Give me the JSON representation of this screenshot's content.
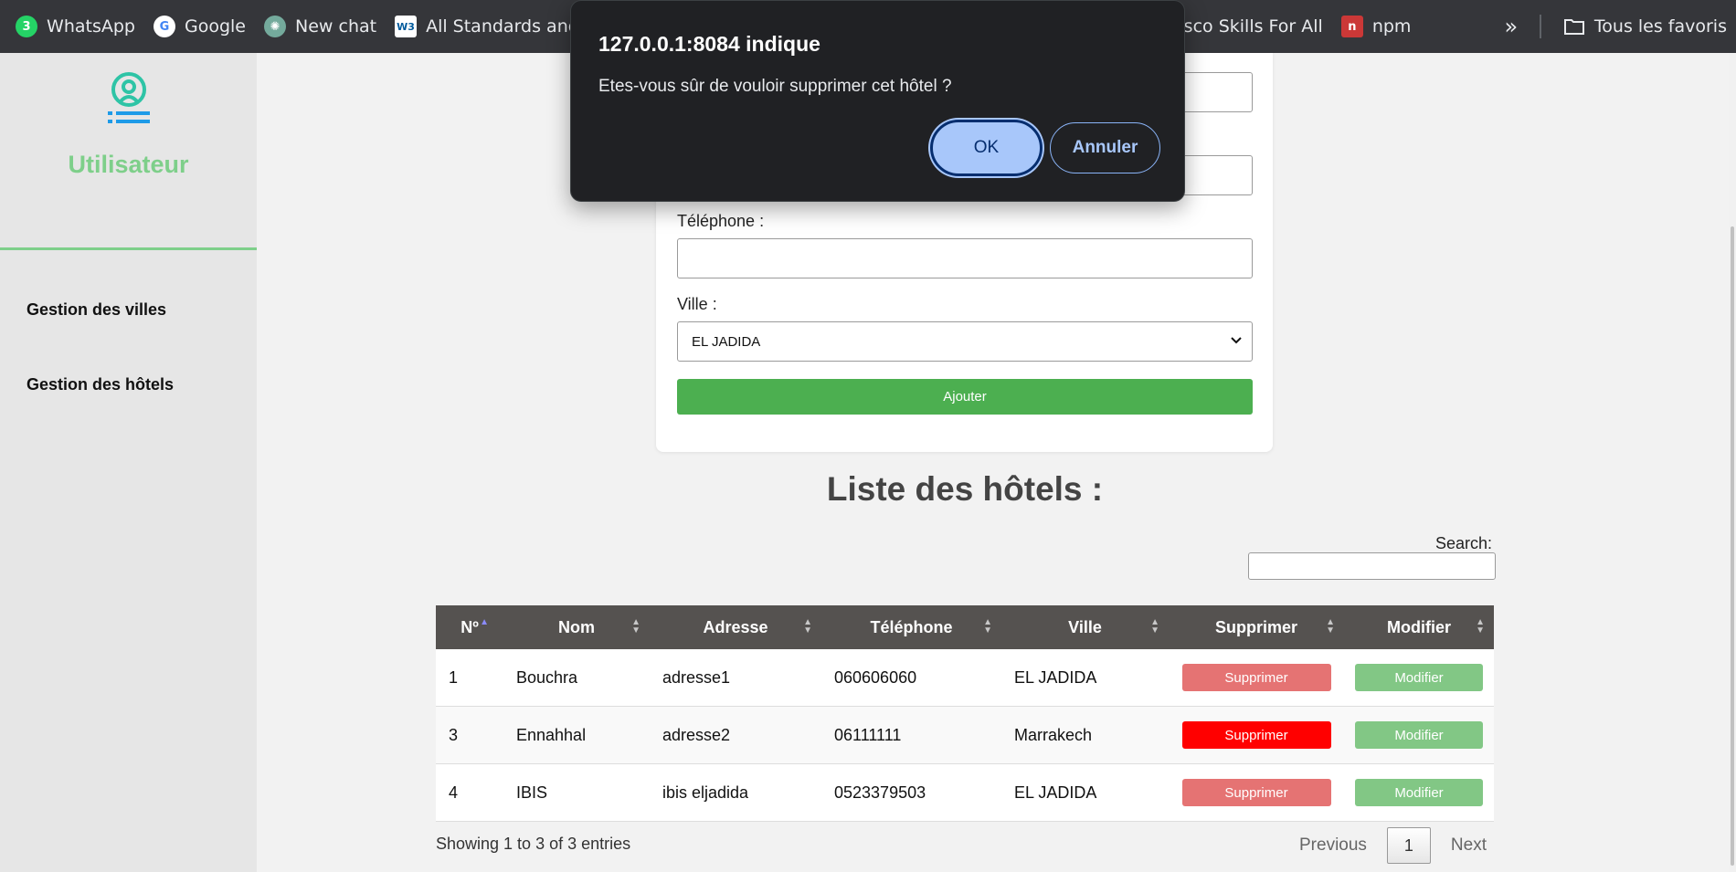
{
  "bookmarks": {
    "items": [
      {
        "label": "WhatsApp",
        "icon": "whatsapp-icon",
        "color": "#25d366",
        "glyph": "3"
      },
      {
        "label": "Google",
        "icon": "google-icon",
        "color": "#4285f4",
        "glyph": "G"
      },
      {
        "label": "New chat",
        "icon": "chatgpt-icon",
        "color": "#74aa9c",
        "glyph": "✺"
      },
      {
        "label": "All Standards and D...",
        "icon": "w3c-icon",
        "color": "#ffffff",
        "glyph": "W3"
      },
      {
        "label": "Cisco Skills For All",
        "icon": "cisco-icon",
        "color": "#35363a",
        "glyph": "cisco"
      },
      {
        "label": "npm",
        "icon": "npm-icon",
        "color": "#cb3837",
        "glyph": "n"
      }
    ],
    "more_glyph": "»",
    "favorites_label": "Tous les favoris"
  },
  "sidebar": {
    "brand": "Utilisateur",
    "brand_color": "#7ecf8a",
    "links": [
      "Gestion des villes",
      "Gestion des hôtels"
    ]
  },
  "form": {
    "telephone_label": "Téléphone :",
    "ville_label": "Ville :",
    "ville_selected": "EL JADIDA",
    "submit_label": "Ajouter",
    "submit_color": "#4caf50"
  },
  "list": {
    "title": "Liste des hôtels :",
    "search_label": "Search:",
    "columns": [
      "Nº",
      "Nom",
      "Adresse",
      "Téléphone",
      "Ville",
      "Supprimer",
      "Modifier"
    ],
    "rows": [
      {
        "num": "1",
        "nom": "Bouchra",
        "adresse": "adresse1",
        "telephone": "060606060",
        "ville": "EL JADIDA",
        "delete_label": "Supprimer",
        "edit_label": "Modifier",
        "delete_color": "#e57373"
      },
      {
        "num": "3",
        "nom": "Ennahhal",
        "adresse": "adresse2",
        "telephone": "06111111",
        "ville": "Marrakech",
        "delete_label": "Supprimer",
        "edit_label": "Modifier",
        "delete_color": "#ff0000"
      },
      {
        "num": "4",
        "nom": "IBIS",
        "adresse": "ibis eljadida",
        "telephone": "0523379503",
        "ville": "EL JADIDA",
        "delete_label": "Supprimer",
        "edit_label": "Modifier",
        "delete_color": "#e57373"
      }
    ],
    "info": "Showing 1 to 3 of 3 entries",
    "pager": {
      "previous": "Previous",
      "current": "1",
      "next": "Next"
    }
  },
  "dialog": {
    "title": "127.0.0.1:8084 indique",
    "message": "Etes-vous sûr de vouloir supprimer cet hôtel ?",
    "ok_label": "OK",
    "cancel_label": "Annuler"
  }
}
